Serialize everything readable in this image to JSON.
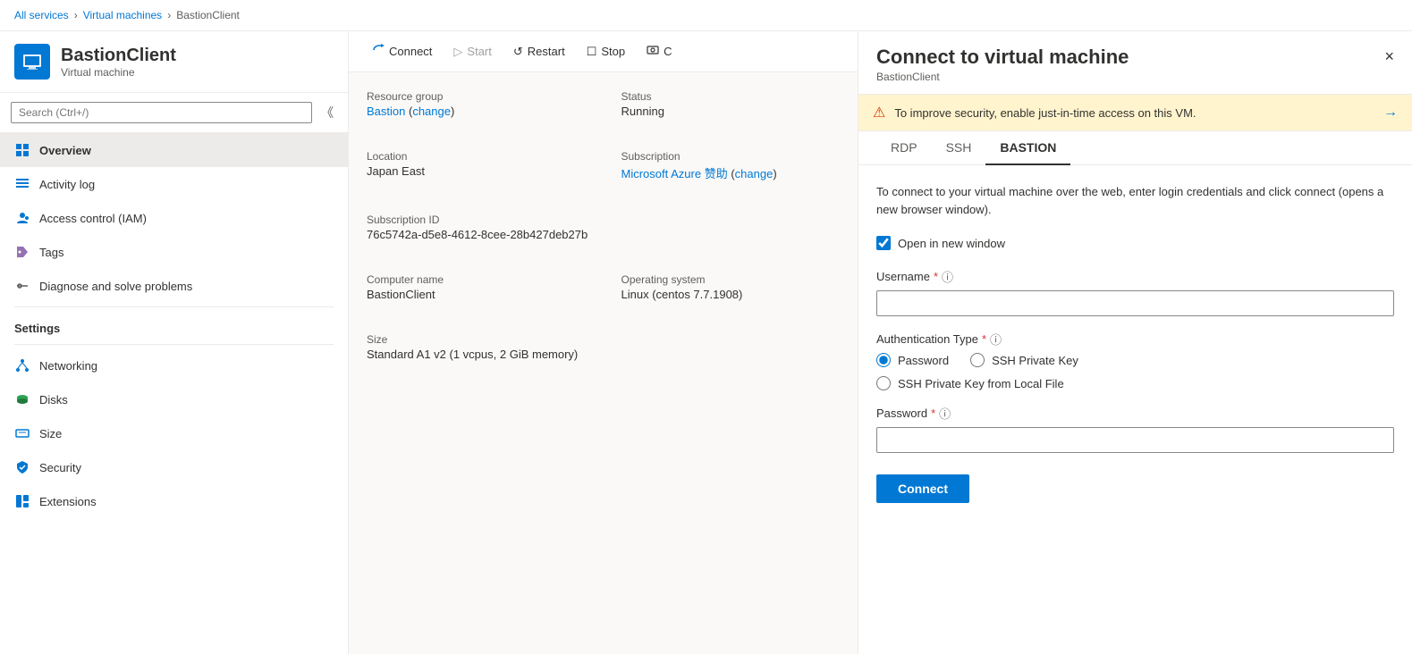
{
  "breadcrumb": {
    "items": [
      "All services",
      "Virtual machines",
      "BastionClient"
    ]
  },
  "vm": {
    "name": "BastionClient",
    "type": "Virtual machine",
    "icon_label": "VM"
  },
  "search": {
    "placeholder": "Search (Ctrl+/)"
  },
  "nav": {
    "main_items": [
      {
        "id": "overview",
        "label": "Overview",
        "icon": "overview"
      },
      {
        "id": "activity-log",
        "label": "Activity log",
        "icon": "activity"
      },
      {
        "id": "access-control",
        "label": "Access control (IAM)",
        "icon": "iam"
      },
      {
        "id": "tags",
        "label": "Tags",
        "icon": "tags"
      },
      {
        "id": "diagnose",
        "label": "Diagnose and solve problems",
        "icon": "diagnose"
      }
    ],
    "settings_label": "Settings",
    "settings_items": [
      {
        "id": "networking",
        "label": "Networking",
        "icon": "networking"
      },
      {
        "id": "disks",
        "label": "Disks",
        "icon": "disks"
      },
      {
        "id": "size",
        "label": "Size",
        "icon": "size"
      },
      {
        "id": "security",
        "label": "Security",
        "icon": "security"
      },
      {
        "id": "extensions",
        "label": "Extensions",
        "icon": "extensions"
      }
    ]
  },
  "toolbar": {
    "buttons": [
      {
        "id": "connect",
        "label": "Connect",
        "icon": "connect"
      },
      {
        "id": "start",
        "label": "Start",
        "icon": "start",
        "disabled": true
      },
      {
        "id": "restart",
        "label": "Restart",
        "icon": "restart"
      },
      {
        "id": "stop",
        "label": "Stop",
        "icon": "stop"
      },
      {
        "id": "capture",
        "label": "C",
        "icon": "capture"
      }
    ]
  },
  "details": {
    "resource_group": {
      "label": "Resource group",
      "value": "Bastion",
      "link": true,
      "change": true
    },
    "status": {
      "label": "Status",
      "value": "Running"
    },
    "location": {
      "label": "Location",
      "value": "Japan East"
    },
    "subscription": {
      "label": "Subscription",
      "value": "Microsoft Azure 赞助",
      "link": true,
      "change": true
    },
    "subscription_id": {
      "label": "Subscription ID",
      "value": "76c5742a-d5e8-4612-8cee-28b427deb27b"
    },
    "computer_name": {
      "label": "Computer name",
      "value": "BastionClient"
    },
    "os": {
      "label": "Operating system",
      "value": "Linux (centos 7.7.1908)"
    },
    "size": {
      "label": "Size",
      "value": "Standard A1 v2 (1 vcpus, 2 GiB memory)"
    }
  },
  "connect_panel": {
    "title": "Connect to virtual machine",
    "subtitle": "BastionClient",
    "close_label": "×",
    "warning": "To improve security, enable just-in-time access on this VM.",
    "tabs": [
      "RDP",
      "SSH",
      "BASTION"
    ],
    "active_tab": "BASTION",
    "description": "To connect to your virtual machine over the web, enter login credentials and click connect (opens a new browser window).",
    "open_new_window_label": "Open in new window",
    "username_label": "Username",
    "auth_type_label": "Authentication Type",
    "auth_options": [
      "Password",
      "SSH Private Key",
      "SSH Private Key from Local File"
    ],
    "password_label": "Password",
    "connect_button": "Connect"
  }
}
